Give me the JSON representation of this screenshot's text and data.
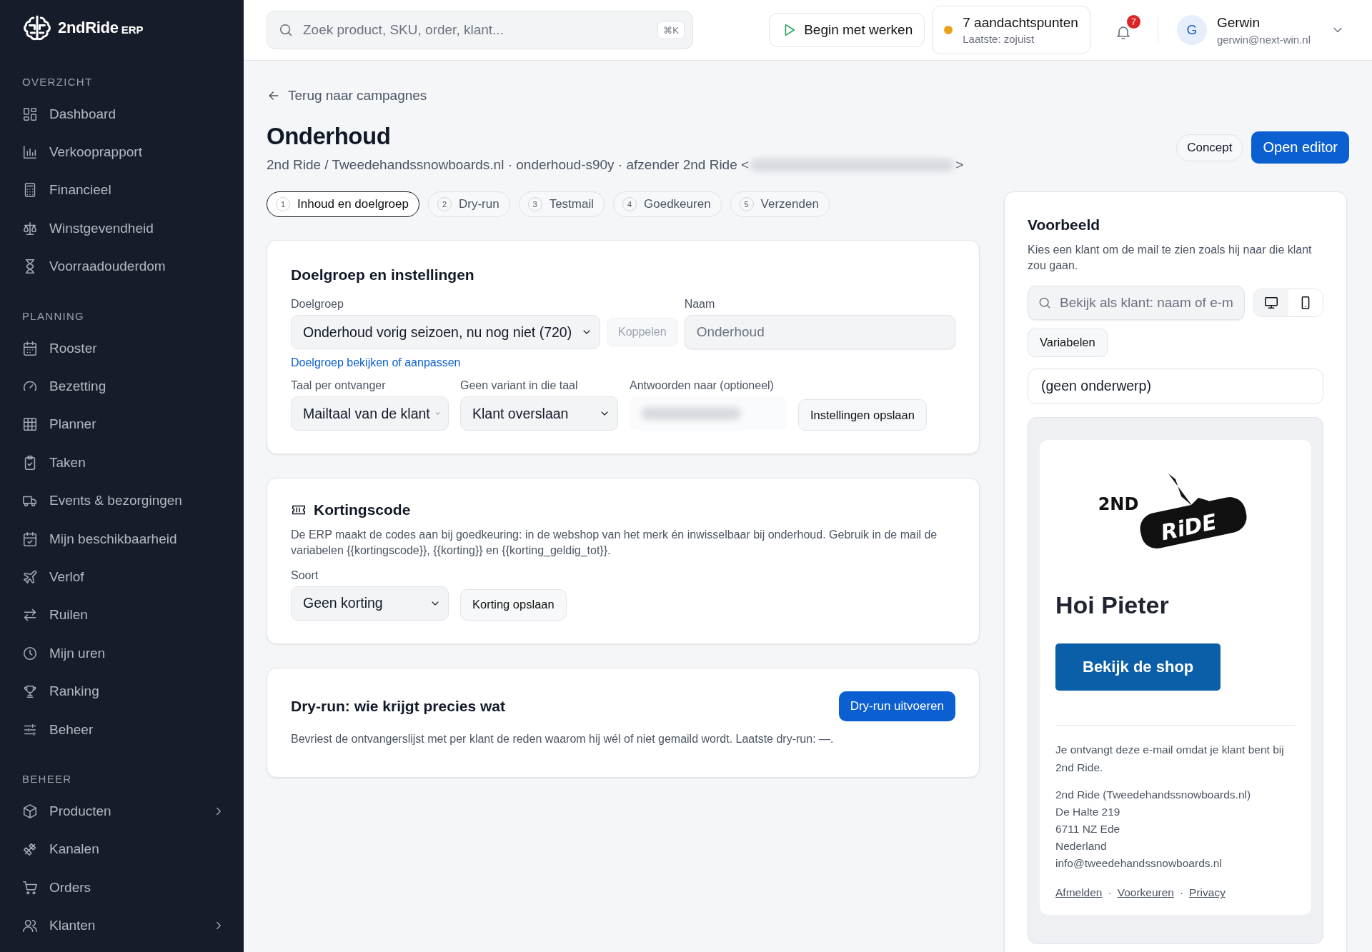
{
  "sidebar": {
    "brand": {
      "name": "2ndRide",
      "suffix": "ERP"
    },
    "sections": [
      {
        "heading": "OVERZICHT",
        "items": [
          {
            "label": "Dashboard",
            "has_submenu": false
          },
          {
            "label": "Verkooprapport",
            "has_submenu": false
          },
          {
            "label": "Financieel",
            "has_submenu": false
          },
          {
            "label": "Winstgevendheid",
            "has_submenu": false
          },
          {
            "label": "Voorraadouderdom",
            "has_submenu": false
          }
        ]
      },
      {
        "heading": "PLANNING",
        "items": [
          {
            "label": "Rooster",
            "has_submenu": false
          },
          {
            "label": "Bezetting",
            "has_submenu": false
          },
          {
            "label": "Planner",
            "has_submenu": false
          },
          {
            "label": "Taken",
            "has_submenu": false
          },
          {
            "label": "Events & bezorgingen",
            "has_submenu": false
          },
          {
            "label": "Mijn beschikbaarheid",
            "has_submenu": false
          },
          {
            "label": "Verlof",
            "has_submenu": false
          },
          {
            "label": "Ruilen",
            "has_submenu": false
          },
          {
            "label": "Mijn uren",
            "has_submenu": false
          },
          {
            "label": "Ranking",
            "has_submenu": false
          },
          {
            "label": "Beheer",
            "has_submenu": false
          }
        ]
      },
      {
        "heading": "BEHEER",
        "items": [
          {
            "label": "Producten",
            "has_submenu": true
          },
          {
            "label": "Kanalen",
            "has_submenu": false
          },
          {
            "label": "Orders",
            "has_submenu": false
          },
          {
            "label": "Klanten",
            "has_submenu": true
          }
        ]
      }
    ]
  },
  "topbar": {
    "search": {
      "placeholder": "Zoek product, SKU, order, klant...",
      "shortcut": "⌘K"
    },
    "start_button": "Begin met werken",
    "attention": {
      "title": "7 aandachtspunten",
      "subtitle": "Laatste: zojuist",
      "color": "#e8a21a"
    },
    "notifications": {
      "count": "7"
    },
    "user": {
      "initial": "G",
      "name": "Gerwin",
      "email": "gerwin@next-win.nl"
    }
  },
  "page": {
    "back_link": "Terug naar campagnes",
    "title": "Onderhoud",
    "subtitle_start": "2nd Ride / Tweedehandssnowboards.nl · onderhoud-s90y · afzender 2nd Ride <",
    "subtitle_end": ">",
    "status_badge": "Concept",
    "open_editor": "Open editor",
    "steps": [
      {
        "number": "1",
        "label": "Inhoud en doelgroep",
        "selected": true
      },
      {
        "number": "2",
        "label": "Dry-run",
        "selected": false
      },
      {
        "number": "3",
        "label": "Testmail",
        "selected": false
      },
      {
        "number": "4",
        "label": "Goedkeuren",
        "selected": false
      },
      {
        "number": "5",
        "label": "Verzenden",
        "selected": false
      }
    ]
  },
  "audience_card": {
    "title": "Doelgroep en instellingen",
    "audience_label": "Doelgroep",
    "audience_value": "Onderhoud vorig seizoen, nu nog niet (720)",
    "link_button": "Koppelen",
    "name_label": "Naam",
    "name_placeholder": "Onderhoud",
    "audience_link": "Doelgroep bekijken of aanpassen",
    "language_label": "Taal per ontvanger",
    "language_value": "Mailtaal van de klant",
    "fallback_label": "Geen variant in die taal",
    "fallback_value": "Klant overslaan",
    "reply_label": "Antwoorden naar (optioneel)",
    "save_button": "Instellingen opslaan"
  },
  "discount_card": {
    "title": "Kortingscode",
    "description": "De ERP maakt de codes aan bij goedkeuring: in de webshop van het merk én inwisselbaar bij onderhoud. Gebruik in de mail de variabelen {{kortingscode}}, {{korting}} en {{korting_geldig_tot}}.",
    "type_label": "Soort",
    "type_value": "Geen korting",
    "save_button": "Korting opslaan"
  },
  "dryrun_card": {
    "title": "Dry-run: wie krijgt precies wat",
    "run_button": "Dry-run uitvoeren",
    "description": "Bevriest de ontvangerslijst met per klant de reden waarom hij wél of niet gemaild wordt. Laatste dry-run: —."
  },
  "preview": {
    "title": "Voorbeeld",
    "description": "Kies een klant om de mail te zien zoals hij naar die klant zou gaan.",
    "customer_search": {
      "placeholder": "Bekijk als klant: naam of e-m"
    },
    "devices": [
      {
        "kind": "desktop",
        "selected": true
      },
      {
        "kind": "mobile",
        "selected": false
      }
    ],
    "variables_button": "Variabelen",
    "subject": "(geen onderwerp)",
    "email": {
      "logo_text": "2ND",
      "logo_board_text": "RiDE",
      "greeting": "Hoi Pieter",
      "cta": "Bekijk de shop",
      "footer_note": "Je ontvangt deze e-mail omdat je klant bent bij 2nd Ride.",
      "address": [
        "2nd Ride (Tweedehandssnowboards.nl)",
        "De Halte 219",
        "6711 NZ Ede",
        "Nederland",
        "info@tweedehandssnowboards.nl"
      ],
      "links": [
        "Afmelden",
        "Voorkeuren",
        "Privacy"
      ],
      "link_separator": "·"
    }
  }
}
